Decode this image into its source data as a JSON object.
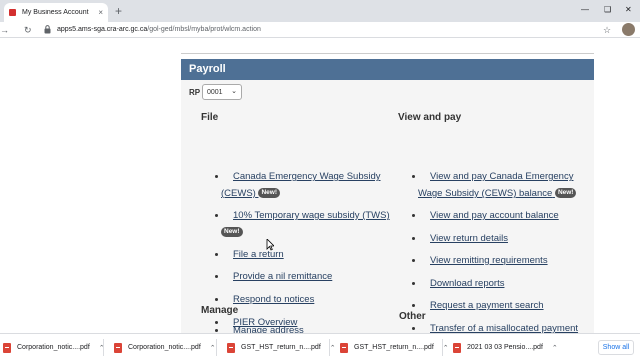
{
  "browser": {
    "tab_title": "My Business Account",
    "new_tab": "+",
    "close_tab": "×",
    "url_host": "apps5.ams-sga.cra-arc.gc.ca",
    "url_path": "/gol-ged/mbsl/myba/prot/wlcm.action",
    "nav_icons": [
      "back-arrow-icon",
      "forward-arrow-icon",
      "reload-icon",
      "lock-icon",
      "star-icon",
      "profile-avatar-icon"
    ],
    "window_icons": [
      "minimize-icon",
      "restore-icon",
      "close-icon"
    ]
  },
  "page": {
    "section_title": "Payroll",
    "rp_label": "RP",
    "rp_value": "0001",
    "file_heading": "File",
    "view_heading": "View and pay",
    "manage_heading": "Manage",
    "other_heading": "Other",
    "badge_new": "New!",
    "file_links": {
      "cews_l1": "Canada Emergency Wage Subsidy",
      "cews_l2": "(CEWS)",
      "tws": "10% Temporary wage subsidy (TWS)",
      "file_return": "File a return",
      "nil": "Provide a nil remittance",
      "respond": "Respond to notices",
      "pier": "PIER Overview"
    },
    "view_links": {
      "cews_l1": "View and pay Canada Emergency",
      "cews_l2": "Wage Subsidy (CEWS) balance",
      "account_balance": "View and pay account balance",
      "return_details": "View return details",
      "remitting": "View remitting requirements",
      "download": "Download reports",
      "payment_search": "Request a payment search",
      "transfer": "Transfer of a misallocated payment"
    },
    "manage_links": {
      "address": "Manage address"
    }
  },
  "downloads": {
    "items": [
      "Corporation_notic....pdf",
      "Corporation_notic....pdf",
      "GST_HST_return_n....pdf",
      "GST_HST_return_n....pdf",
      "2021 03 03 Pensio....pdf"
    ],
    "show_all": "Show all"
  },
  "colors": {
    "header_bar": "#4e7095",
    "link": "#284162",
    "badge": "#555555",
    "pdf": "#db4437"
  }
}
